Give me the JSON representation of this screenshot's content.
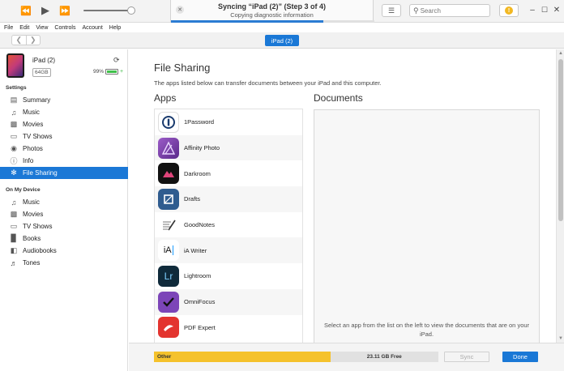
{
  "titlebar": {
    "sync_title": "Syncing “iPad (2)” (Step 3 of 4)",
    "sync_status": "Copying diagnostic information",
    "sync_progress": 0.75,
    "search_placeholder": "Search",
    "volume_level": 0.9
  },
  "menu": [
    "File",
    "Edit",
    "View",
    "Controls",
    "Account",
    "Help"
  ],
  "navbar": {
    "device_tab": "iPad (2)"
  },
  "device": {
    "name": "iPad (2)",
    "capacity": "64GB",
    "battery": "99%",
    "battery_level": 0.99
  },
  "sidebar": {
    "settings_header": "Settings",
    "settings_items": [
      {
        "label": "Summary",
        "icon": "summary-icon"
      },
      {
        "label": "Music",
        "icon": "music-note-icon"
      },
      {
        "label": "Movies",
        "icon": "film-icon"
      },
      {
        "label": "TV Shows",
        "icon": "tv-icon"
      },
      {
        "label": "Photos",
        "icon": "camera-icon"
      },
      {
        "label": "Info",
        "icon": "info-icon"
      },
      {
        "label": "File Sharing",
        "icon": "app-store-icon",
        "selected": true
      }
    ],
    "device_header": "On My Device",
    "device_items": [
      {
        "label": "Music",
        "icon": "music-note-icon"
      },
      {
        "label": "Movies",
        "icon": "film-icon"
      },
      {
        "label": "TV Shows",
        "icon": "tv-icon"
      },
      {
        "label": "Books",
        "icon": "book-icon"
      },
      {
        "label": "Audiobooks",
        "icon": "audiobook-icon"
      },
      {
        "label": "Tones",
        "icon": "bell-icon"
      }
    ]
  },
  "main": {
    "title": "File Sharing",
    "description": "The apps listed below can transfer documents between your iPad and this computer.",
    "apps_header": "Apps",
    "documents_header": "Documents",
    "documents_hint": "Select an app from the list on the left to view the documents that are on your iPad.",
    "apps": [
      {
        "name": "1Password",
        "icon": "1password-icon",
        "color": "#ffffff"
      },
      {
        "name": "Affinity Photo",
        "icon": "affinity-photo-icon",
        "color": "#7a3fa8"
      },
      {
        "name": "Darkroom",
        "icon": "darkroom-icon",
        "color": "#111111"
      },
      {
        "name": "Drafts",
        "icon": "drafts-icon",
        "color": "#2f5c8f"
      },
      {
        "name": "GoodNotes",
        "icon": "goodnotes-icon",
        "color": "#ffffff"
      },
      {
        "name": "iA Writer",
        "icon": "ia-writer-icon",
        "color": "#ffffff"
      },
      {
        "name": "Lightroom",
        "icon": "lightroom-icon",
        "color": "#0f2a3a"
      },
      {
        "name": "OmniFocus",
        "icon": "omnifocus-icon",
        "color": "#7c45b8"
      },
      {
        "name": "PDF Expert",
        "icon": "pdf-expert-icon",
        "color": "#e3342f"
      }
    ]
  },
  "footer": {
    "storage_other_label": "Other",
    "storage_other_fraction": 0.62,
    "storage_free_label": "23.11 GB Free",
    "sync_label": "Sync",
    "done_label": "Done"
  },
  "colors": {
    "accent": "#1a78d6",
    "storage_other": "#f5c22c",
    "storage_free": "#e1e1e1",
    "battery": "#3fbf4a"
  }
}
